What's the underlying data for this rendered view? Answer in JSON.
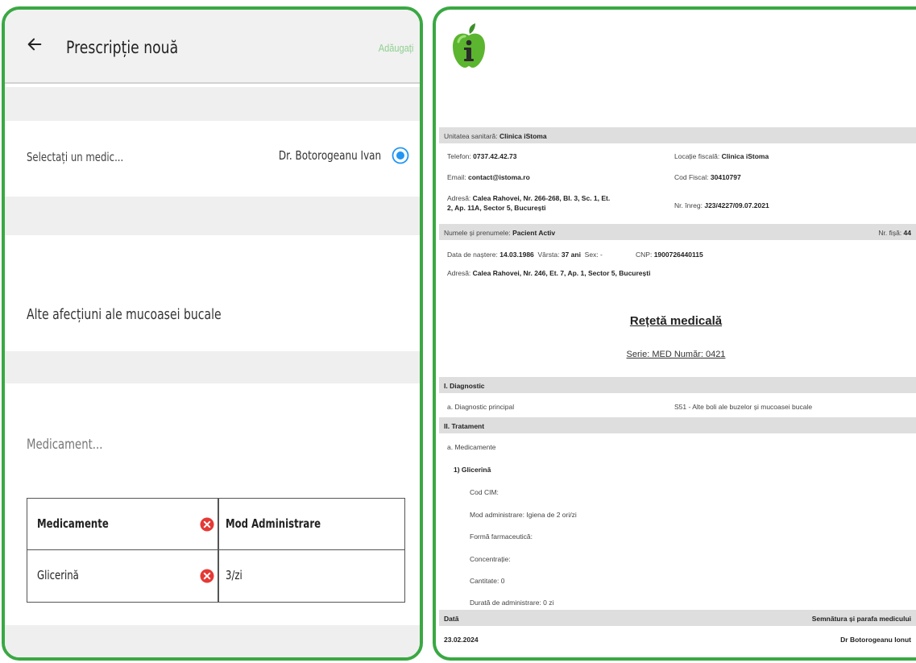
{
  "form": {
    "title": "Prescripție nouă",
    "add_label": "Adăugați",
    "select_doctor_placeholder": "Selectați un medic...",
    "selected_doctor": "Dr. Botorogeanu Ivan",
    "diagnosis": "Alte afecțiuni ale mucoasei bucale",
    "medicament_placeholder": "Medicament...",
    "table": {
      "headers": [
        "Medicamente",
        "Mod Administrare"
      ],
      "rows": [
        {
          "medicament": "Glicerină",
          "mod": "3/zi"
        }
      ]
    }
  },
  "prescription": {
    "unit_label": "Unitatea sanitară:",
    "unit_value": "Clinica iStoma",
    "phone_label": "Telefon:",
    "phone_value": "0737.42.42.73",
    "fiscal_location_label": "Locație fiscală:",
    "fiscal_location_value": "Clinica iStoma",
    "email_label": "Email:",
    "email_value": "contact@istoma.ro",
    "fiscal_code_label": "Cod Fiscal:",
    "fiscal_code_value": "30410797",
    "address_label": "Adresă:",
    "address_line1": "Calea Rahovei, Nr. 266-268, Bl. 3, Sc. 1, Et.",
    "address_line2": "2, Ap. 11A, Sector 5, București",
    "reg_no_label": "Nr. înreg:",
    "reg_no_value": "J23/4227/09.07.2021",
    "patient_name_label": "Numele și prenumele:",
    "patient_name_value": "Pacient Activ",
    "file_no_label": "Nr. fișă:",
    "file_no_value": "44",
    "birth_label": "Data de naștere:",
    "birth_value": "14.03.1986",
    "age_label": "Vârsta:",
    "age_value": "37 ani",
    "sex_label": "Sex: -",
    "cnp_label": "CNP:",
    "cnp_value": "1900726440115",
    "patient_address_label": "Adresă:",
    "patient_address_value": "Calea Rahovei, Nr. 246, Et. 7, Ap. 1, Sector 5, București",
    "title": "Rețetă medicală",
    "serie": "Serie: MED Număr: 0421",
    "section_diagnostic": "I. Diagnostic",
    "main_diag_label": "a. Diagnostic principal",
    "main_diag_value": "S51 - Alte boli ale buzelor și mucoasei bucale",
    "section_treatment": "II. Tratament",
    "meds_label": "a. Medicamente",
    "med_name": "1) Glicerină",
    "cod_cim": "Cod CIM:",
    "mod_admin": "Mod administrare: Igiena de 2 ori/zi",
    "forma": "Formă farmaceutică:",
    "concentratie": "Concentrație:",
    "cantitate": "Cantitate: 0",
    "durata": "Durată de administrare: 0 zi",
    "date_label": "Dată",
    "signature_label": "Semnătura și parafa medicului",
    "date_value": "23.02.2024",
    "doctor_value": "Dr Botorogeanu Ionut"
  },
  "colors": {
    "frame_green": "#3aa843",
    "accent_blue": "#2196f3",
    "remove_red": "#e53935",
    "band_gray": "#dedede"
  }
}
